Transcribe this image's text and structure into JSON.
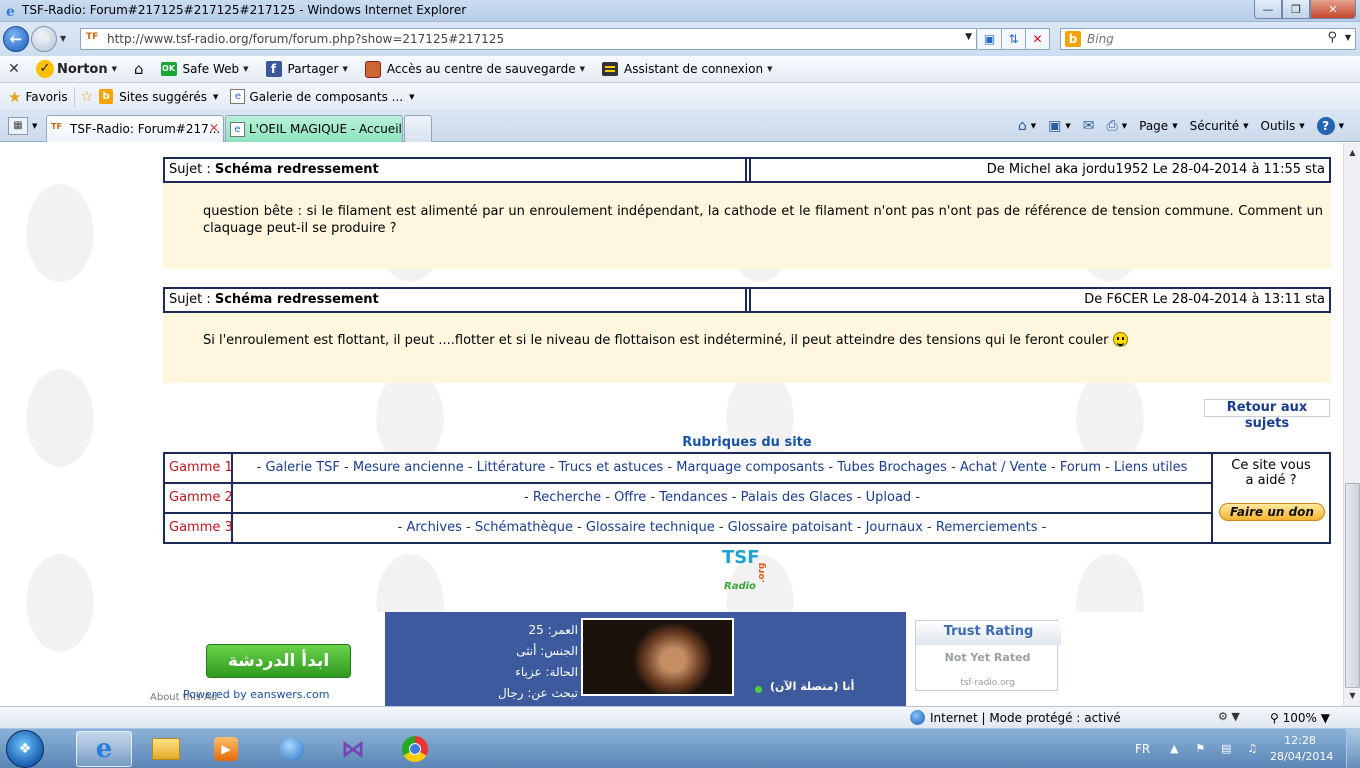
{
  "window": {
    "title": "TSF-Radio: Forum#217125#217125#217125 - Windows Internet Explorer"
  },
  "address_bar": {
    "url": "http://www.tsf-radio.org/forum/forum.php?show=217125#217125",
    "search_placeholder": "Bing"
  },
  "norton_toolbar": {
    "items": [
      "Norton",
      "Safe Web",
      "Partager",
      "Accès au centre de sauvegarde",
      "Assistant de connexion"
    ],
    "ok_badge": "OK"
  },
  "favorites_bar": {
    "favorites_label": "Favoris",
    "items": [
      "Sites suggérés",
      "Galerie de composants ..."
    ]
  },
  "tabs": [
    {
      "label": "TSF-Radio: Forum#217...",
      "active": true
    },
    {
      "label": "L'OEIL MAGIQUE - Accueil",
      "active": false
    }
  ],
  "command_bar": {
    "items": [
      "Page",
      "Sécurité",
      "Outils"
    ]
  },
  "posts": [
    {
      "subject_prefix": "Sujet :",
      "subject": "Schéma redressement",
      "meta": "De Michel aka jordu1952  Le 28-04-2014 à 11:55 sta",
      "body": "question bête : si le filament est alimenté par un enroulement indépendant, la cathode et le filament n'ont pas n'ont pas de référence de tension commune. Comment un claquage peut-il se produire ?"
    },
    {
      "subject_prefix": "Sujet :",
      "subject": "Schéma redressement",
      "meta": "De F6CER  Le 28-04-2014 à 13:11 sta",
      "body": "Si l'enroulement est flottant, il peut ....flotter et si le niveau de flottaison est indéterminé, il peut atteindre des tensions qui le feront couler"
    }
  ],
  "retour_label": "Retour aux sujets",
  "rubriques": {
    "title": "Rubriques du site",
    "rows": [
      {
        "label": "Gamme 1",
        "links": [
          "Galerie TSF",
          "Mesure ancienne",
          "Littérature",
          "Trucs et astuces",
          "Marquage composants",
          "Tubes Brochages",
          "Achat / Vente",
          "Forum",
          "Liens utiles"
        ]
      },
      {
        "label": "Gamme 2",
        "links": [
          "Recherche",
          "Offre",
          "Tendances",
          "Palais des Glaces",
          "Upload"
        ]
      },
      {
        "label": "Gamme 3",
        "links": [
          "Archives",
          "Schémathèque",
          "Glossaire technique",
          "Glossaire patoisant",
          "Journaux",
          "Remerciements"
        ]
      }
    ],
    "aide_text": "Ce site vous a aidé ?",
    "don_button": "Faire un don"
  },
  "logo_text": {
    "line1": "TSF",
    "line2": "Radio",
    "suffix": ".org"
  },
  "ad": {
    "chat_button": "ابدأ الدردشة",
    "powered_by": "Powered by eanswers.com",
    "about_ads": "About this Ad",
    "profile_lines": [
      "العمر: 25",
      "الجنس: أنثى",
      "الحالة: عزباء",
      "تبحث عن: رجال"
    ],
    "online_status": "أنا (متصلة الآن)"
  },
  "trust_rating": {
    "title": "Trust Rating",
    "status": "Not Yet Rated",
    "site": "tsf-radio.org"
  },
  "status_bar": {
    "zone": "Internet | Mode protégé : activé",
    "zoom": "100%"
  },
  "taskbar": {
    "language": "FR",
    "time": "12:28",
    "date": "28/04/2014"
  }
}
